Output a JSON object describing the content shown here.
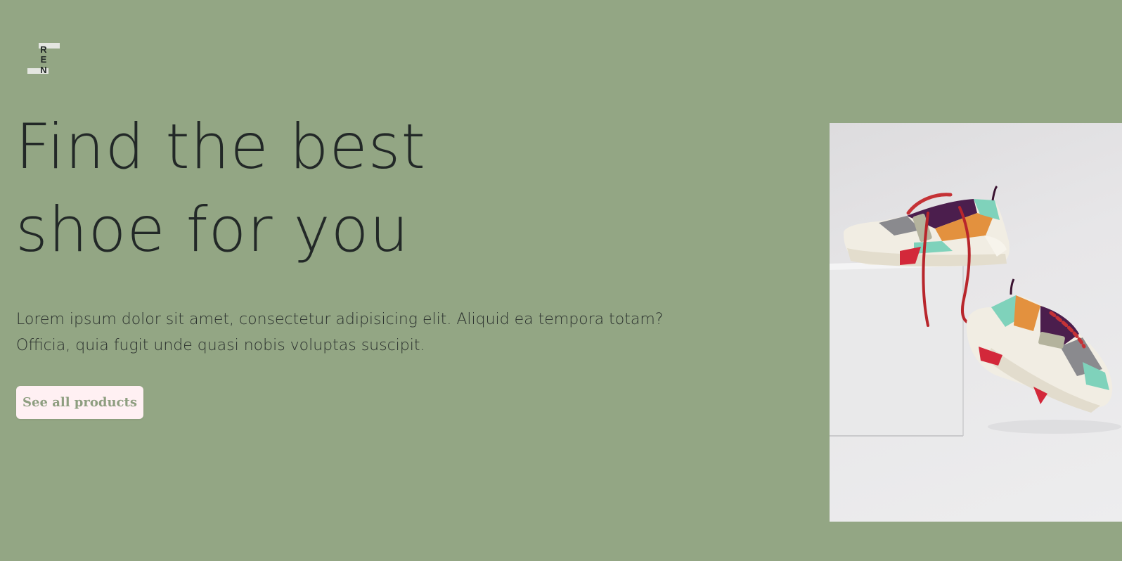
{
  "logo": {
    "letters": [
      "R",
      "E",
      "N"
    ],
    "icon": "ren-logo-icon"
  },
  "hero": {
    "headline_lines": [
      "Find the best",
      "shoe for you"
    ],
    "description_lines": [
      "Lorem ipsum dolor sit amet, consectetur adipisicing elit. Aliquid ea tempora totam?",
      "Officia, quia fugit unde quasi nobis voluptas suscipit."
    ],
    "cta_label": "See all products"
  },
  "photo": {
    "subject": "pair of colorful sneakers on white pedestal"
  },
  "colors": {
    "background": "#93a684",
    "text": "#222827",
    "button_bg": "#fff0f3",
    "button_text": "#8e9e80"
  }
}
